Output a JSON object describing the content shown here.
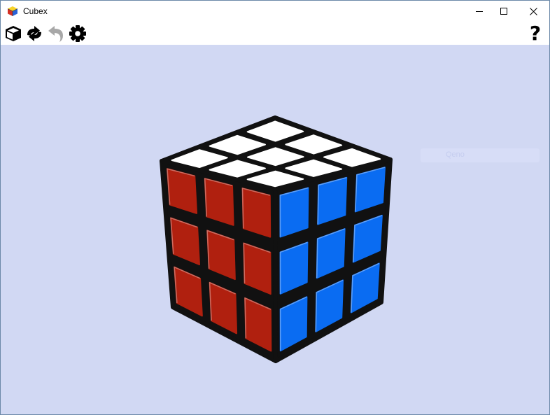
{
  "window": {
    "title": "Cubex",
    "controls": [
      "minimize-icon",
      "maximize-icon",
      "close-icon"
    ]
  },
  "toolbar": {
    "buttons": [
      {
        "icon": "cube-icon",
        "enabled": true
      },
      {
        "icon": "scramble-arrows-icon",
        "enabled": true
      },
      {
        "icon": "undo-icon",
        "enabled": false
      },
      {
        "icon": "gear-icon",
        "enabled": true
      }
    ],
    "help_label": "?"
  },
  "viewport": {
    "background": "#d1d8f3",
    "ghost_label": "Qeno"
  },
  "cube": {
    "size": 3,
    "top_color": "#ffffff",
    "front_color": "#b0200f",
    "right_color": "#0a6cf2",
    "border_color": "#111111"
  }
}
